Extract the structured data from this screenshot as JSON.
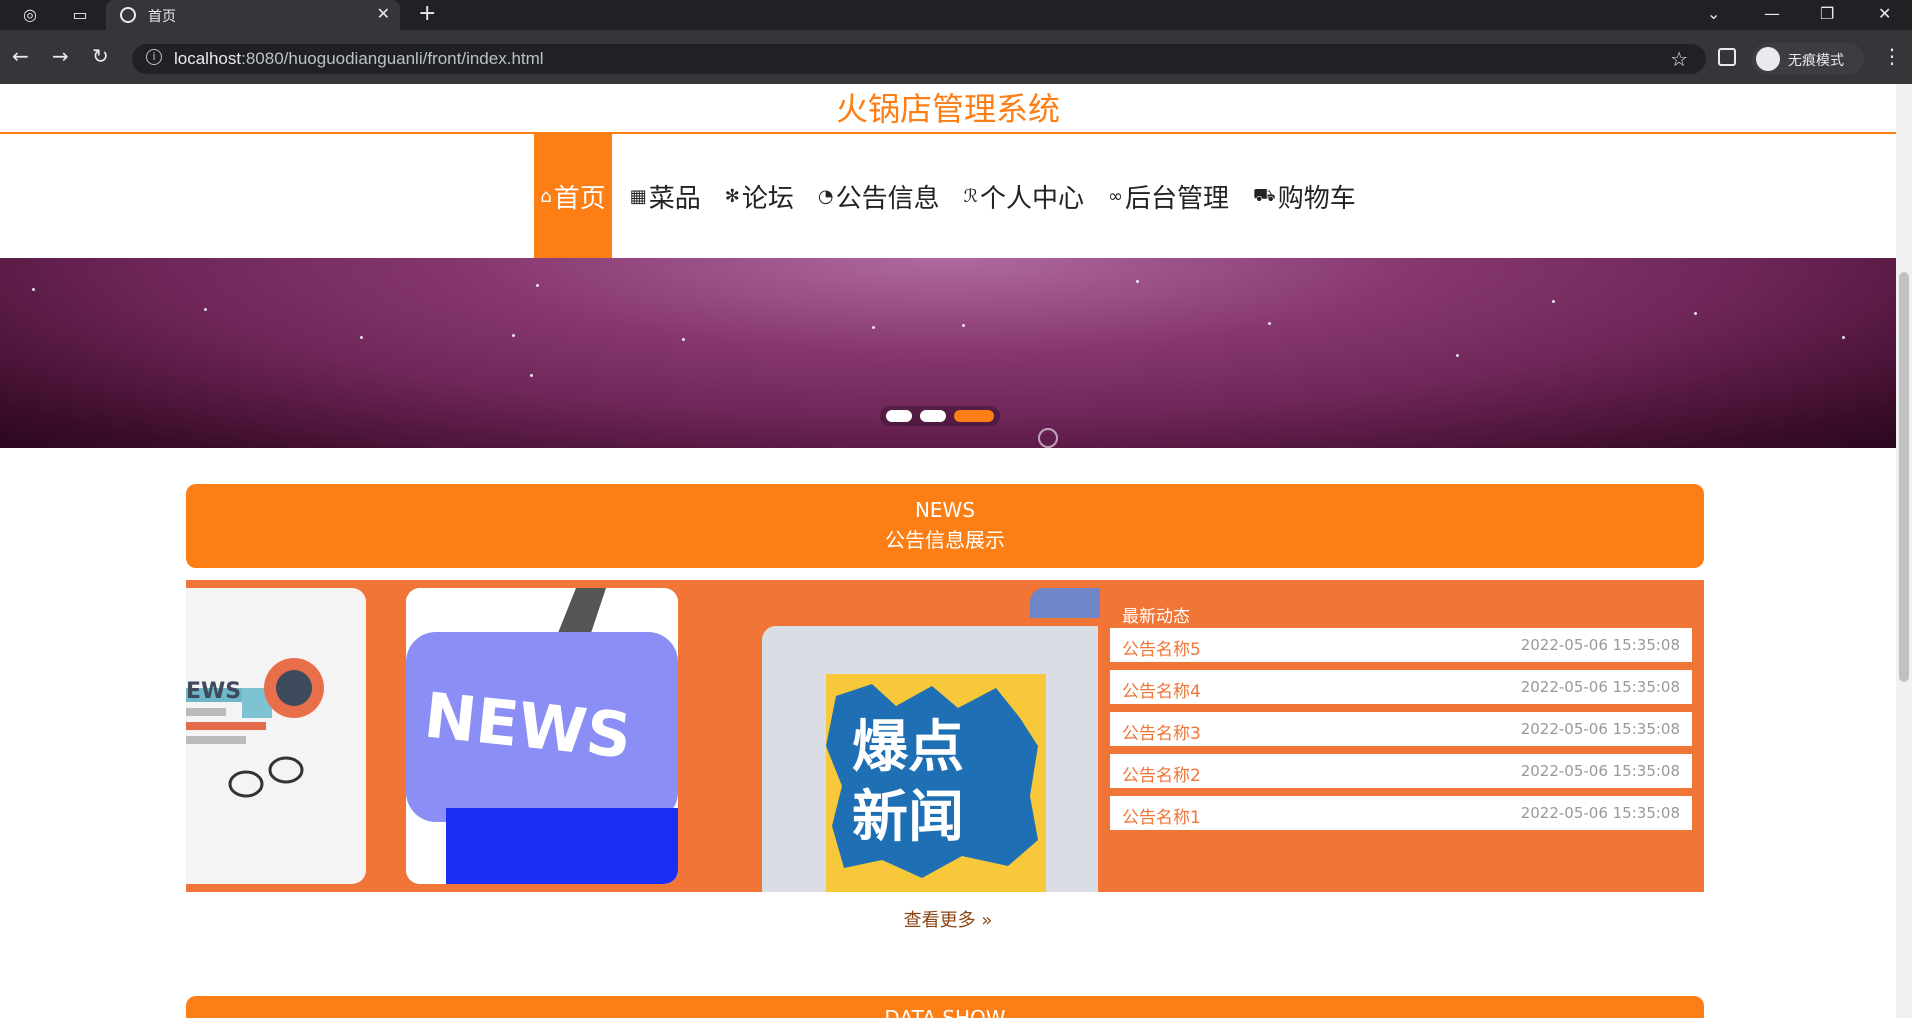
{
  "browser": {
    "tab_title": "首页",
    "url_host": "localhost",
    "url_path": ":8080/huoguodianguanli/front/index.html",
    "incognito_label": "无痕模式"
  },
  "site": {
    "title": "火锅店管理系统",
    "nav": [
      {
        "label": "首页",
        "icon": "⌂",
        "active": true
      },
      {
        "label": "菜品",
        "icon": "▦"
      },
      {
        "label": "论坛",
        "icon": "✻"
      },
      {
        "label": "公告信息",
        "icon": "◔"
      },
      {
        "label": "个人中心",
        "icon": "ℛ"
      },
      {
        "label": "后台管理",
        "icon": "∞"
      },
      {
        "label": "购物车",
        "icon": "⛟"
      }
    ]
  },
  "news": {
    "heading_en": "NEWS",
    "heading_cn": "公告信息展示",
    "list_title": "最新动态",
    "items": [
      {
        "name": "公告名称5",
        "date": "2022-05-06 15:35:08"
      },
      {
        "name": "公告名称4",
        "date": "2022-05-06 15:35:08"
      },
      {
        "name": "公告名称3",
        "date": "2022-05-06 15:35:08"
      },
      {
        "name": "公告名称2",
        "date": "2022-05-06 15:35:08"
      },
      {
        "name": "公告名称1",
        "date": "2022-05-06 15:35:08"
      }
    ],
    "more_label": "查看更多 »",
    "card_texts": {
      "c1": "EWS",
      "c2": "NEWS",
      "c3_line1": "爆点",
      "c3_line2": "新闻"
    }
  },
  "data_section": {
    "heading_partial": "DATA SHOW"
  },
  "colors": {
    "accent": "#fd7e14",
    "panel": "#f07536"
  }
}
